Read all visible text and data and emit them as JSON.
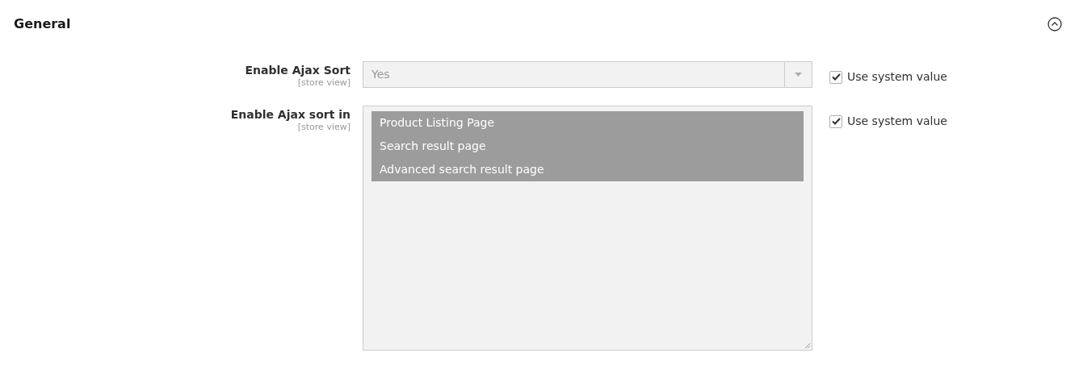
{
  "section": {
    "title": "General",
    "expanded": true
  },
  "fields": [
    {
      "kind": "select",
      "label": "Enable Ajax Sort",
      "scope": "[store view]",
      "value": "Yes",
      "disabled": true,
      "use_system_value": {
        "label": "Use system value",
        "checked": true
      }
    },
    {
      "kind": "multiselect",
      "label": "Enable Ajax sort in",
      "scope": "[store view]",
      "disabled": true,
      "options": [
        {
          "label": "Product Listing Page",
          "selected": true
        },
        {
          "label": "Search result page",
          "selected": true
        },
        {
          "label": "Advanced search result page",
          "selected": true
        }
      ],
      "use_system_value": {
        "label": "Use system value",
        "checked": true
      }
    }
  ]
}
